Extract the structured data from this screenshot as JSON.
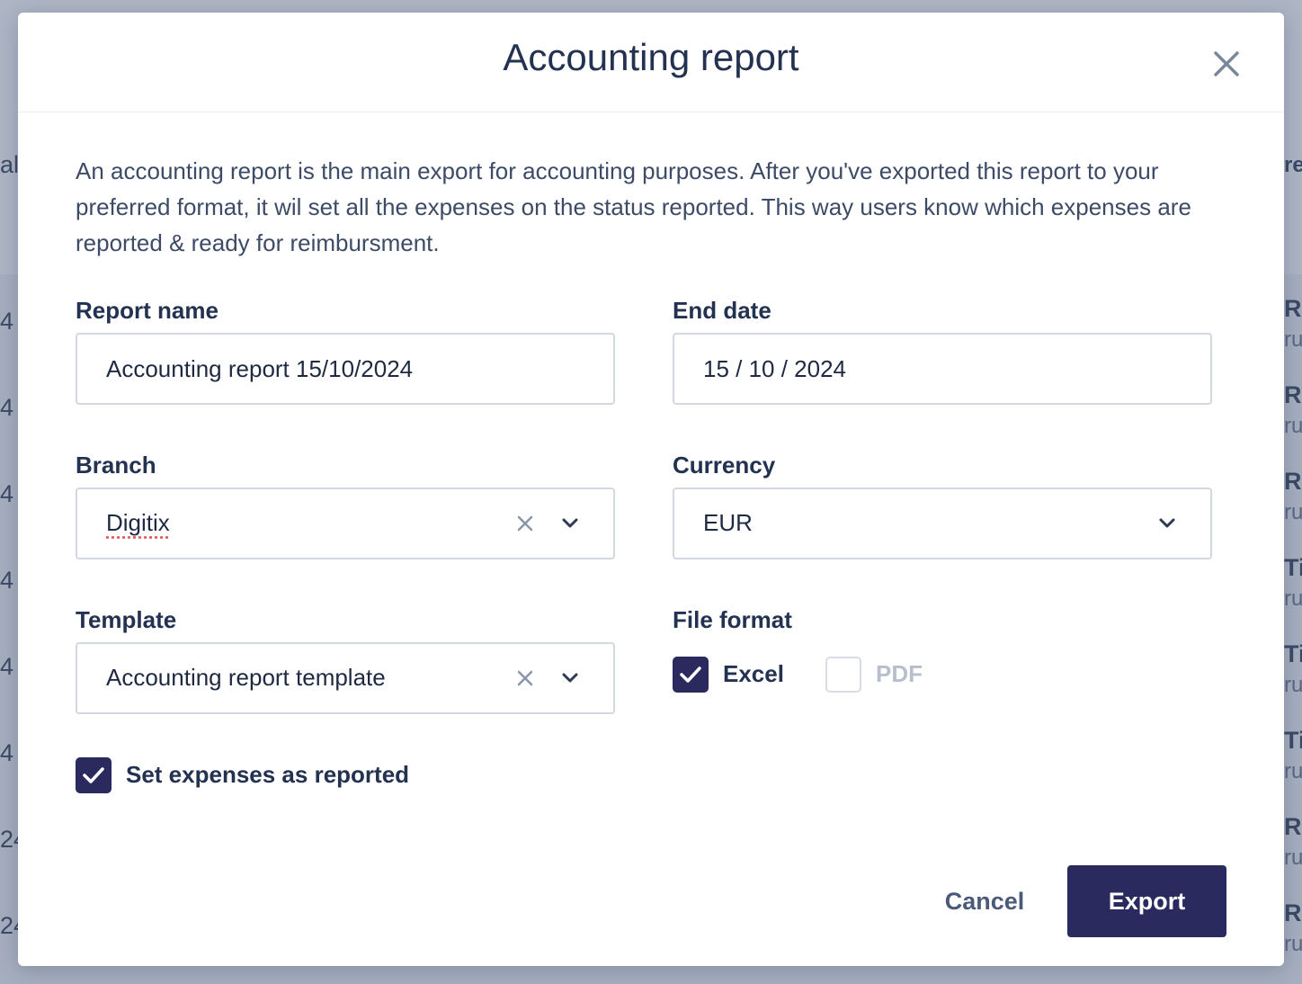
{
  "background": {
    "left_fragments": [
      "al",
      "4",
      "4",
      "4",
      "4",
      "4",
      "4",
      "24",
      "24"
    ],
    "right_fragments": [
      {
        "title": "re",
        "sub": ""
      },
      {
        "title": "R",
        "sub": "ru"
      },
      {
        "title": "R",
        "sub": "ru"
      },
      {
        "title": "R",
        "sub": "ru"
      },
      {
        "title": "Ti",
        "sub": "ru"
      },
      {
        "title": "Ti",
        "sub": "ru"
      },
      {
        "title": "Ti",
        "sub": "ru"
      },
      {
        "title": "R",
        "sub": "ru"
      },
      {
        "title": "R",
        "sub": "ru"
      }
    ]
  },
  "modal": {
    "title": "Accounting report",
    "description": "An accounting report is the main export for accounting purposes. After you've exported this report to your preferred format, it wil set all the expenses on the status reported. This way users know which expenses are reported & ready for reimbursment.",
    "report_name": {
      "label": "Report name",
      "value": "Accounting report 15/10/2024"
    },
    "end_date": {
      "label": "End date",
      "value": "15 / 10 / 2024"
    },
    "branch": {
      "label": "Branch",
      "value": "Digitix"
    },
    "currency": {
      "label": "Currency",
      "value": "EUR"
    },
    "template": {
      "label": "Template",
      "value": "Accounting report template"
    },
    "file_format": {
      "label": "File format",
      "options": [
        {
          "label": "Excel",
          "checked": true
        },
        {
          "label": "PDF",
          "checked": false
        }
      ]
    },
    "set_reported": {
      "label": "Set expenses as reported",
      "checked": true
    },
    "buttons": {
      "cancel": "Cancel",
      "export": "Export"
    }
  },
  "colors": {
    "primary": "#2a2a5e",
    "heading": "#233251",
    "body_text": "#3d4b67",
    "border": "#d3d8e0",
    "overlay": "#a6afbf"
  },
  "icons": {
    "close": "close-icon",
    "clear": "clear-icon",
    "dropdown": "chevron-down-icon",
    "check": "checkmark-icon"
  }
}
